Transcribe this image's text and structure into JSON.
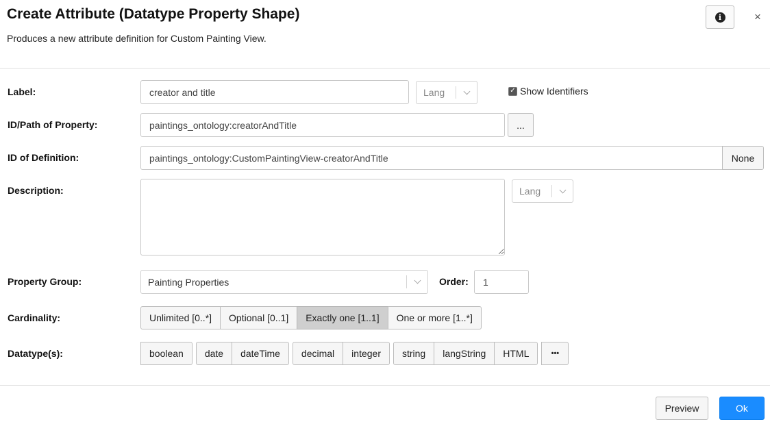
{
  "dialog": {
    "title": "Create Attribute (Datatype Property Shape)",
    "subtitle": "Produces a new attribute definition for Custom Painting View.",
    "info_icon": "info-icon",
    "close_glyph": "×"
  },
  "form": {
    "label": {
      "label": "Label:",
      "value": "creator and title",
      "lang_placeholder": "Lang"
    },
    "show_identifiers": {
      "label": "Show Identifiers",
      "checked": true,
      "check_glyph": "✓"
    },
    "property_id": {
      "label": "ID/Path of Property:",
      "value": "paintings_ontology:creatorAndTitle",
      "browse_label": "..."
    },
    "definition_id": {
      "label": "ID of Definition:",
      "value": "paintings_ontology:CustomPaintingView-creatorAndTitle",
      "none_label": "None"
    },
    "description": {
      "label": "Description:",
      "value": "",
      "lang_placeholder": "Lang"
    },
    "property_group": {
      "label": "Property Group:",
      "value": "Painting Properties"
    },
    "order": {
      "label": "Order:",
      "value": "1"
    },
    "cardinality": {
      "label": "Cardinality:",
      "options": [
        "Unlimited [0..*]",
        "Optional [0..1]",
        "Exactly one [1..1]",
        "One or more [1..*]"
      ],
      "selected": "Exactly one [1..1]"
    },
    "datatypes": {
      "label": "Datatype(s):",
      "groups": [
        [
          "boolean"
        ],
        [
          "date",
          "dateTime"
        ],
        [
          "decimal",
          "integer"
        ],
        [
          "string",
          "langString",
          "HTML"
        ]
      ],
      "more_label": "•••"
    }
  },
  "footer": {
    "preview_label": "Preview",
    "ok_label": "Ok"
  },
  "colors": {
    "primary": "#1a8cff",
    "active_toggle": "#cfcfcf",
    "border": "#c8c8c8"
  }
}
